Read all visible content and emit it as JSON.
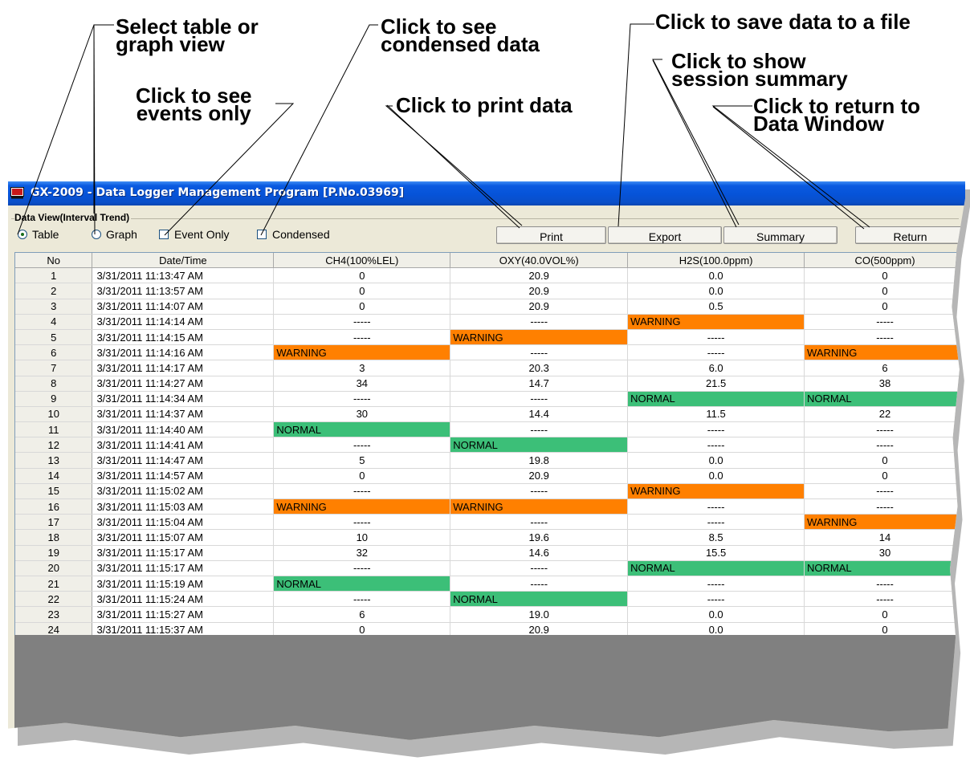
{
  "callouts": {
    "select_view": "Select table or\ngraph view",
    "condensed": "Click to see\ncondensed data",
    "save": "Click to save data to a file",
    "summary": "Click to show\nsession summary",
    "events": "Click to see\nevents only",
    "print": "Click to print data",
    "return": "Click to return to\nData Window"
  },
  "window": {
    "title": "GX-2009  - Data Logger Management Program [P.No.03969]",
    "group_label": "Data View(Interval Trend)",
    "view_options": {
      "table": "Table",
      "graph": "Graph",
      "selected": "Table"
    },
    "filters": {
      "event_only": "Event Only",
      "condensed": "Condensed"
    },
    "buttons": {
      "print": "Print",
      "export": "Export",
      "summary": "Summary",
      "return": "Return"
    }
  },
  "colors": {
    "warning": "#ff8000",
    "normal": "#3cbf78",
    "titlebar": "#0a5ae0"
  },
  "table": {
    "columns": [
      "No",
      "Date/Time",
      "CH4(100%LEL)",
      "OXY(40.0VOL%)",
      "H2S(100.0ppm)",
      "CO(500ppm)"
    ],
    "rows": [
      [
        "1",
        "3/31/2011 11:13:47 AM",
        "0",
        "20.9",
        "0.0",
        "0"
      ],
      [
        "2",
        "3/31/2011 11:13:57 AM",
        "0",
        "20.9",
        "0.0",
        "0"
      ],
      [
        "3",
        "3/31/2011 11:14:07 AM",
        "0",
        "20.9",
        "0.5",
        "0"
      ],
      [
        "4",
        "3/31/2011 11:14:14 AM",
        "-----",
        "-----",
        "WARNING",
        "-----"
      ],
      [
        "5",
        "3/31/2011 11:14:15 AM",
        "-----",
        "WARNING",
        "-----",
        "-----"
      ],
      [
        "6",
        "3/31/2011 11:14:16 AM",
        "WARNING",
        "-----",
        "-----",
        "WARNING"
      ],
      [
        "7",
        "3/31/2011 11:14:17 AM",
        "3",
        "20.3",
        "6.0",
        "6"
      ],
      [
        "8",
        "3/31/2011 11:14:27 AM",
        "34",
        "14.7",
        "21.5",
        "38"
      ],
      [
        "9",
        "3/31/2011 11:14:34 AM",
        "-----",
        "-----",
        "NORMAL",
        "NORMAL"
      ],
      [
        "10",
        "3/31/2011 11:14:37 AM",
        "30",
        "14.4",
        "11.5",
        "22"
      ],
      [
        "11",
        "3/31/2011 11:14:40 AM",
        "NORMAL",
        "-----",
        "-----",
        "-----"
      ],
      [
        "12",
        "3/31/2011 11:14:41 AM",
        "-----",
        "NORMAL",
        "-----",
        "-----"
      ],
      [
        "13",
        "3/31/2011 11:14:47 AM",
        "5",
        "19.8",
        "0.0",
        "0"
      ],
      [
        "14",
        "3/31/2011 11:14:57 AM",
        "0",
        "20.9",
        "0.0",
        "0"
      ],
      [
        "15",
        "3/31/2011 11:15:02 AM",
        "-----",
        "-----",
        "WARNING",
        "-----"
      ],
      [
        "16",
        "3/31/2011 11:15:03 AM",
        "WARNING",
        "WARNING",
        "-----",
        "-----"
      ],
      [
        "17",
        "3/31/2011 11:15:04 AM",
        "-----",
        "-----",
        "-----",
        "WARNING"
      ],
      [
        "18",
        "3/31/2011 11:15:07 AM",
        "10",
        "19.6",
        "8.5",
        "14"
      ],
      [
        "19",
        "3/31/2011 11:15:17 AM",
        "32",
        "14.6",
        "15.5",
        "30"
      ],
      [
        "20",
        "3/31/2011 11:15:17 AM",
        "-----",
        "-----",
        "NORMAL",
        "NORMAL"
      ],
      [
        "21",
        "3/31/2011 11:15:19 AM",
        "NORMAL",
        "-----",
        "-----",
        "-----"
      ],
      [
        "22",
        "3/31/2011 11:15:24 AM",
        "-----",
        "NORMAL",
        "-----",
        "-----"
      ],
      [
        "23",
        "3/31/2011 11:15:27 AM",
        "6",
        "19.0",
        "0.0",
        "0"
      ],
      [
        "24",
        "3/31/2011 11:15:37 AM",
        "0",
        "20.9",
        "0.0",
        "0"
      ]
    ]
  }
}
